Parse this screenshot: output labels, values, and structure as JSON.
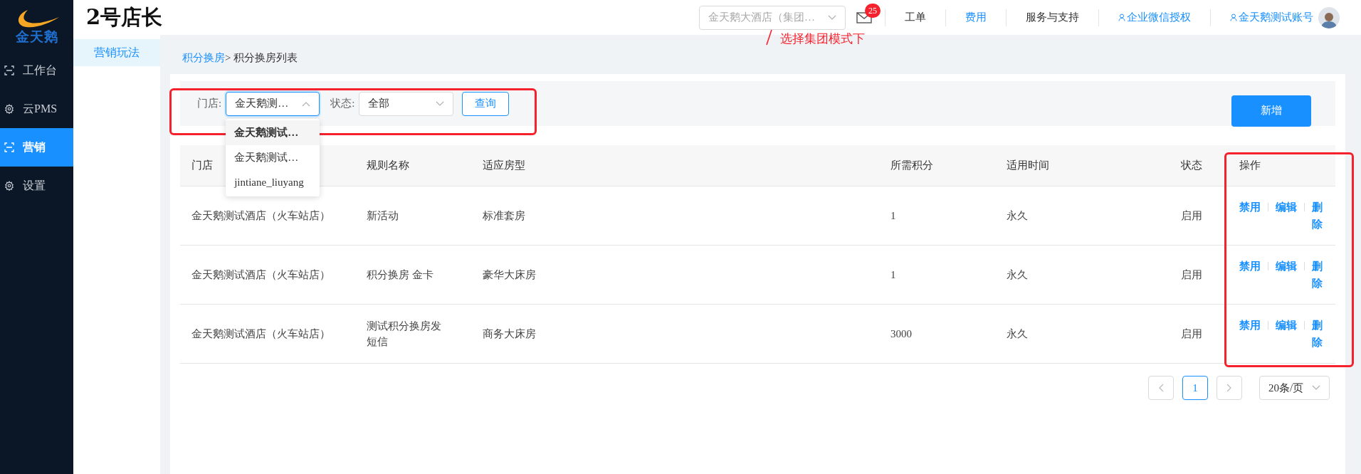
{
  "sidebar": {
    "logo_text": "金天鹅",
    "items": [
      {
        "label": "工作台",
        "kind": "scan",
        "selected": false
      },
      {
        "label": "云PMS",
        "kind": "gear",
        "selected": false
      },
      {
        "label": "营销",
        "kind": "scan",
        "selected": true
      },
      {
        "label": "设置",
        "kind": "gear",
        "selected": false
      }
    ]
  },
  "app_title": "2号店长",
  "header": {
    "store_select": "金天鹅大酒店（集团…",
    "badge": "25",
    "nav": [
      {
        "label": "工单",
        "kind": "plain"
      },
      {
        "label": "费用",
        "kind": "link"
      },
      {
        "label": "服务与支持",
        "kind": "plain"
      },
      {
        "label": "企业微信授权",
        "kind": "user_link"
      },
      {
        "label": "金天鹅测试账号",
        "kind": "user_link"
      }
    ]
  },
  "annotation": "选择集团模式下",
  "submenu": [
    {
      "label": "营销玩法",
      "selected": true
    }
  ],
  "breadcrumb": {
    "link": "积分换房",
    "current": "> 积分换房列表"
  },
  "filters": {
    "store_label": "门店:",
    "store_value": "金天鹅测…",
    "store_expanded": true,
    "status_label": "状态:",
    "status_value": "全部",
    "query_button": "查询"
  },
  "store_options": [
    {
      "label": "金天鹅测试…",
      "selected": true
    },
    {
      "label": "金天鹅测试…",
      "selected": false
    },
    {
      "label": "jintiane_liuyang",
      "selected": false
    }
  ],
  "add_button": "新增",
  "table": {
    "columns": [
      "门店",
      "规则名称",
      "适应房型",
      "所需积分",
      "适用时间",
      "状态",
      "操作"
    ],
    "rows": [
      {
        "cells": [
          "金天鹅测试酒店（火车站店）",
          "新活动",
          "标准套房",
          "1",
          "永久",
          "启用"
        ],
        "actions": [
          "禁用",
          "编辑",
          "删除"
        ]
      },
      {
        "cells": [
          "金天鹅测试酒店（火车站店）",
          "积分换房 金卡",
          "豪华大床房",
          "1",
          "永久",
          "启用"
        ],
        "actions": [
          "禁用",
          "编辑",
          "删除"
        ]
      },
      {
        "cells": [
          "金天鹅测试酒店（火车站店）",
          "测试积分换房发短信",
          "商务大床房",
          "3000",
          "永久",
          "启用"
        ],
        "actions": [
          "禁用",
          "编辑",
          "删除"
        ]
      }
    ]
  },
  "pagination": {
    "pages": [
      {
        "label": "1",
        "selected": true
      }
    ],
    "page_size": "20条/页"
  }
}
